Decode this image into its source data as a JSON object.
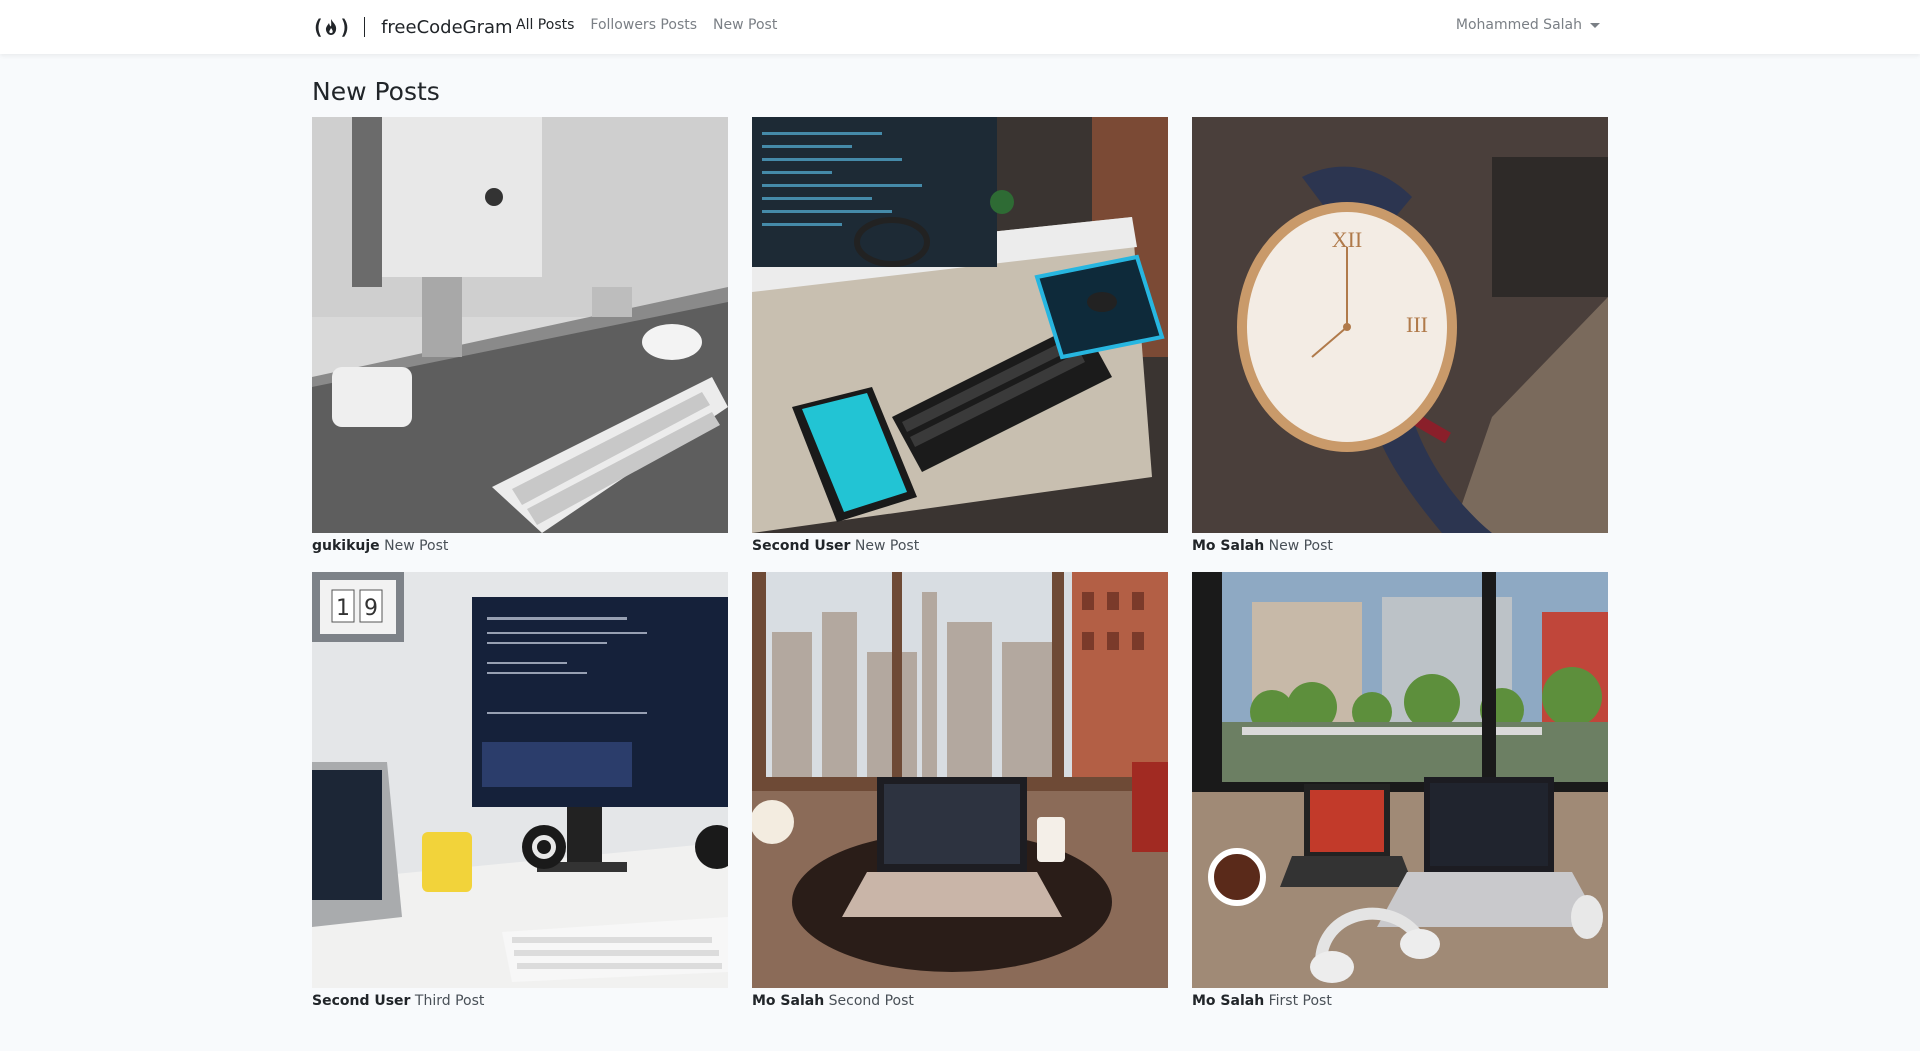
{
  "navbar": {
    "brand_name": "freeCodeGram",
    "links": [
      {
        "label": "All Posts",
        "active": true
      },
      {
        "label": "Followers Posts",
        "active": false
      },
      {
        "label": "New Post",
        "active": false
      }
    ],
    "user_name": "Mohammed Salah"
  },
  "page": {
    "title": "New Posts"
  },
  "posts": [
    {
      "user": "gukikuje",
      "caption": "New Post",
      "image": "desk-imac-keyboard"
    },
    {
      "user": "Second User",
      "caption": "New Post",
      "image": "desk-monitor-tablet"
    },
    {
      "user": "Mo Salah",
      "caption": "New Post",
      "image": "wristwatch"
    },
    {
      "user": "Second User",
      "caption": "Third Post",
      "image": "desk-dell-monitor"
    },
    {
      "user": "Mo Salah",
      "caption": "Second Post",
      "image": "city-window-laptop"
    },
    {
      "user": "Mo Salah",
      "caption": "First Post",
      "image": "window-laptops-headphones"
    }
  ],
  "colors": {
    "navbar_bg": "#ffffff",
    "page_bg": "#f8fafc",
    "text": "#212529",
    "muted": "#7a7f85"
  }
}
